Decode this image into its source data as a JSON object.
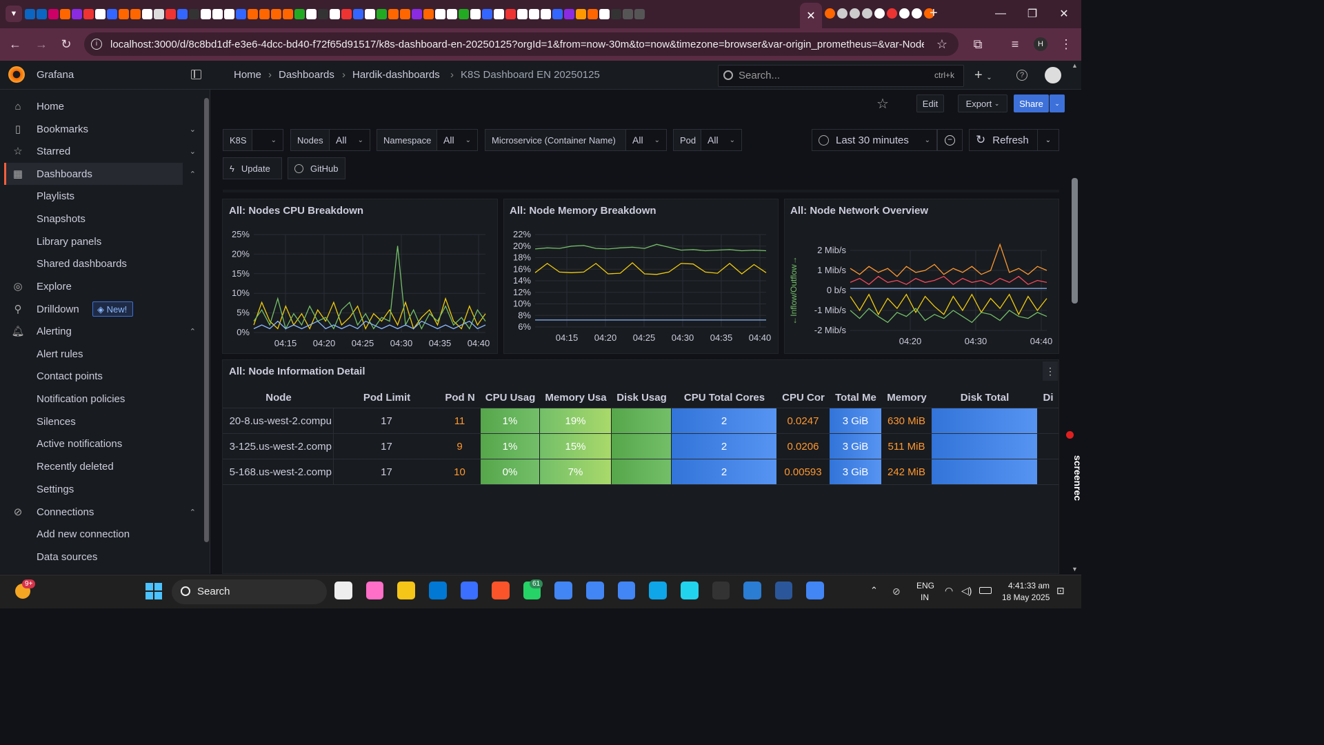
{
  "browser": {
    "url": "localhost:3000/d/8c8bd1df-e3e6-4dcc-bd40-f72f65d91517/k8s-dashboard-en-20250125?orgId=1&from=now-30m&to=now&timezone=browser&var-origin_prometheus=&var-Node=$...",
    "profile_initial": "H"
  },
  "topbar": {
    "brand": "Grafana",
    "breadcrumb": [
      "Home",
      "Dashboards",
      "Hardik-dashboards",
      "K8S Dashboard EN 20250125"
    ],
    "search_placeholder": "Search...",
    "search_shortcut": "ctrl+k"
  },
  "sidebar": {
    "items": [
      {
        "label": "Home",
        "icon": "home-icon"
      },
      {
        "label": "Bookmarks",
        "icon": "bookmark-icon"
      },
      {
        "label": "Starred",
        "icon": "star-icon"
      },
      {
        "label": "Dashboards",
        "icon": "grid-icon"
      },
      {
        "label": "Explore",
        "icon": "compass-icon"
      },
      {
        "label": "Drilldown",
        "icon": "drilldown-icon"
      },
      {
        "label": "Alerting",
        "icon": "bell-icon"
      },
      {
        "label": "Connections",
        "icon": "link-icon"
      }
    ],
    "dashboards_sub": [
      "Playlists",
      "Snapshots",
      "Library panels",
      "Shared dashboards"
    ],
    "alerting_sub": [
      "Alert rules",
      "Contact points",
      "Notification policies",
      "Silences",
      "Active notifications",
      "Recently deleted",
      "Settings"
    ],
    "connections_sub": [
      "Add new connection",
      "Data sources"
    ],
    "new_badge": "New!"
  },
  "toolbar": {
    "edit": "Edit",
    "export": "Export",
    "share": "Share"
  },
  "variables": {
    "k8s_label": "K8S",
    "nodes_label": "Nodes",
    "nodes_value": "All",
    "namespace_label": "Namespace",
    "namespace_value": "All",
    "microservice_label": "Microservice (Container Name)",
    "microservice_value": "All",
    "pod_label": "Pod",
    "pod_value": "All",
    "time_range": "Last 30 minutes",
    "refresh": "Refresh",
    "update_link": "Update",
    "github_link": "GitHub"
  },
  "panels": {
    "cpu_title": "All:  Nodes CPU Breakdown",
    "mem_title": "All:  Node Memory Breakdown",
    "net_title": "All:  Node Network Overview",
    "table_title": "All:  Node Information Detail"
  },
  "chart_data": [
    {
      "type": "line",
      "title": "All:  Nodes CPU Breakdown",
      "x": [
        "04:15",
        "04:20",
        "04:25",
        "04:30",
        "04:35",
        "04:40"
      ],
      "yticks": [
        "25%",
        "20%",
        "15%",
        "10%",
        "5%",
        "0%"
      ],
      "ylim": [
        0,
        26
      ],
      "series": [
        {
          "color": "#f2cc0c",
          "values": [
            2,
            8,
            3,
            1,
            7,
            2,
            5,
            1,
            6,
            3,
            8,
            2,
            4,
            7,
            1,
            5,
            3,
            6,
            2,
            8,
            1,
            4,
            6,
            2,
            9,
            3,
            1,
            7,
            2,
            5
          ]
        },
        {
          "color": "#73bf69",
          "values": [
            3,
            6,
            2,
            9,
            1,
            5,
            2,
            7,
            3,
            4,
            1,
            6,
            8,
            2,
            5,
            1,
            4,
            3,
            23,
            2,
            6,
            1,
            5,
            3,
            7,
            2,
            4,
            1,
            6,
            3
          ]
        },
        {
          "color": "#8ab8ff",
          "values": [
            1,
            2,
            1,
            3,
            1,
            2,
            1,
            2,
            3,
            1,
            2,
            1,
            2,
            1,
            3,
            2,
            1,
            2,
            1,
            2,
            1,
            3,
            2,
            1,
            2,
            1,
            2,
            3,
            1,
            2
          ]
        }
      ]
    },
    {
      "type": "line",
      "title": "All:  Node Memory Breakdown",
      "x": [
        "04:15",
        "04:20",
        "04:25",
        "04:30",
        "04:35",
        "04:40"
      ],
      "yticks": [
        "22%",
        "20%",
        "18%",
        "16%",
        "14%",
        "12%",
        "10%",
        "8%",
        "6%"
      ],
      "ylim": [
        6,
        22
      ],
      "series": [
        {
          "color": "#73bf69",
          "values": [
            19.5,
            19.7,
            19.6,
            20,
            20.1,
            19.6,
            19.5,
            19.7,
            19.8,
            19.6,
            20.3,
            19.8,
            19.3,
            19.4,
            19.2,
            19.3,
            19.4,
            19.2,
            19.3,
            19.2
          ]
        },
        {
          "color": "#f2cc0c",
          "values": [
            15.4,
            17,
            15.5,
            15.4,
            15.5,
            17,
            15.2,
            15.3,
            17.1,
            15.2,
            15.1,
            15.5,
            17,
            16.9,
            15.5,
            15.3,
            17,
            15.2,
            16.8,
            15.4
          ]
        },
        {
          "color": "#8ab8ff",
          "values": [
            7.2,
            7.2,
            7.2,
            7.2,
            7.2,
            7.2,
            7.2,
            7.2,
            7.2,
            7.2,
            7.2,
            7.2,
            7.2,
            7.2,
            7.2,
            7.2,
            7.2,
            7.2,
            7.2,
            7.2
          ]
        }
      ]
    },
    {
      "type": "line",
      "title": "All:  Node Network Overview",
      "ylabel": "←Inflow/Outflow→",
      "x": [
        "04:20",
        "04:30",
        "04:40"
      ],
      "yticks": [
        "2 Mib/s",
        "1 Mib/s",
        "0 b/s",
        "-1 Mib/s",
        "-2 Mib/s"
      ],
      "ylim": [
        -2,
        2
      ],
      "series": [
        {
          "color": "#ff9830",
          "values": [
            1.1,
            0.8,
            1.2,
            0.9,
            1.1,
            0.7,
            1.2,
            0.9,
            1.0,
            1.3,
            0.8,
            1.1,
            0.9,
            1.2,
            0.8,
            1.0,
            2.3,
            0.9,
            1.1,
            0.8,
            1.2,
            1.0
          ]
        },
        {
          "color": "#f2495c",
          "values": [
            0.4,
            0.6,
            0.3,
            0.7,
            0.4,
            0.5,
            0.3,
            0.6,
            0.4,
            0.5,
            0.7,
            0.3,
            0.6,
            0.4,
            0.5,
            0.3,
            0.6,
            0.4,
            0.7,
            0.3,
            0.5,
            0.4
          ]
        },
        {
          "color": "#8ab8ff",
          "values": [
            0.1,
            0.1,
            0.1,
            0.1,
            0.1,
            0.1,
            0.1,
            0.1,
            0.1,
            0.1,
            0.1,
            0.1,
            0.1,
            0.1,
            0.1,
            0.1,
            0.1,
            0.1,
            0.1,
            0.1,
            0.1,
            0.1
          ]
        },
        {
          "color": "#f2cc0c",
          "values": [
            -0.3,
            -1.0,
            -0.2,
            -1.2,
            -0.4,
            -0.9,
            -0.2,
            -1.1,
            -0.3,
            -0.8,
            -1.2,
            -0.3,
            -1.0,
            -0.2,
            -1.1,
            -0.4,
            -0.9,
            -0.2,
            -1.2,
            -0.3,
            -1.0,
            -0.4
          ]
        },
        {
          "color": "#73bf69",
          "values": [
            -1.0,
            -1.4,
            -0.9,
            -1.3,
            -1.6,
            -1.1,
            -1.3,
            -0.9,
            -1.5,
            -1.2,
            -1.4,
            -1.0,
            -1.3,
            -1.6,
            -1.1,
            -1.2,
            -1.5,
            -1.0,
            -1.3,
            -1.4,
            -1.1,
            -1.3
          ]
        }
      ]
    }
  ],
  "table": {
    "headers": [
      "Node",
      "Pod Limit",
      "Pod N",
      "CPU Usag",
      "Memory Usa",
      "Disk Usag",
      "CPU Total Cores",
      "CPU Cor",
      "Total Me",
      "Memory",
      "Disk Total",
      "Di"
    ],
    "rows": [
      {
        "node": "20-8.us-west-2.compu",
        "pod_limit": "17",
        "pod_n": "11",
        "cpu": "1%",
        "mem": "19%",
        "disk": "",
        "cores": "2",
        "cpu_cor": "0.0247",
        "total_mem": "3 GiB",
        "memory": "630 MiB",
        "disk_total": ""
      },
      {
        "node": "3-125.us-west-2.comp",
        "pod_limit": "17",
        "pod_n": "9",
        "cpu": "1%",
        "mem": "15%",
        "disk": "",
        "cores": "2",
        "cpu_cor": "0.0206",
        "total_mem": "3 GiB",
        "memory": "511 MiB",
        "disk_total": ""
      },
      {
        "node": "5-168.us-west-2.comp",
        "pod_limit": "17",
        "pod_n": "10",
        "cpu": "0%",
        "mem": "7%",
        "disk": "",
        "cores": "2",
        "cpu_cor": "0.00593",
        "total_mem": "3 GiB",
        "memory": "242 MiB",
        "disk_total": ""
      }
    ]
  },
  "taskbar": {
    "search": "Search",
    "lang_1": "ENG",
    "lang_2": "IN",
    "time": "4:41:33 am",
    "date": "18 May 2025",
    "widget_badge": "9+",
    "whatsapp_badge": "61"
  },
  "screenrec": "screenrec",
  "colors": {
    "accent": "#3d71d9",
    "green": "#73bf69",
    "yellow": "#f2cc0c",
    "orange": "#ff9830",
    "blue": "#8ab8ff"
  }
}
